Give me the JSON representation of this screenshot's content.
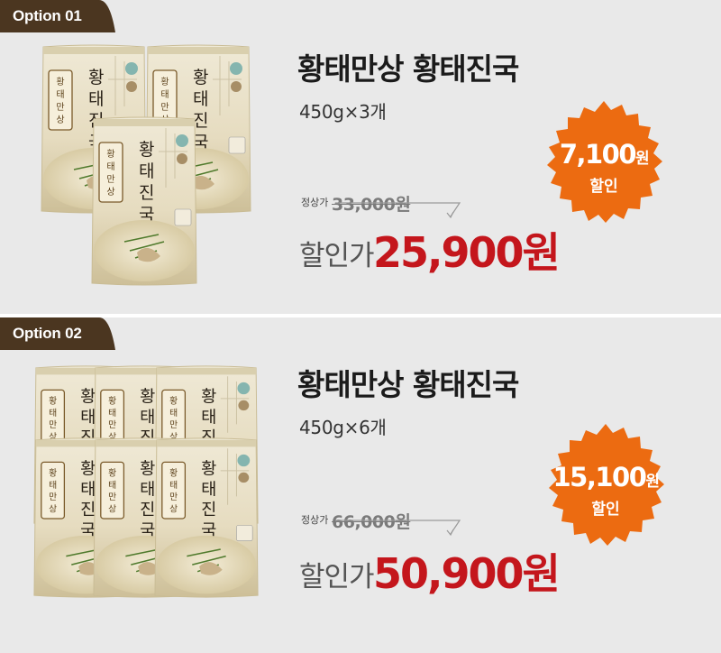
{
  "colors": {
    "tab": "#4b3620",
    "badge": "#ec6b11",
    "sale_price": "#c4161c",
    "panel_bg": "#e9e9e9",
    "pouch": "#e8dfc4"
  },
  "pouch_text": "황태진국",
  "options": [
    {
      "tab_label": "Option 01",
      "title": "황태만상 황태진국",
      "subtitle": "450g×3개",
      "regular_label": "정상가",
      "regular_price": "33,000원",
      "sale_label": "할인가",
      "sale_price": "25,900원",
      "discount_amount": "7,100",
      "discount_unit": "원",
      "discount_label": "할인",
      "pouch_count": 3
    },
    {
      "tab_label": "Option 02",
      "title": "황태만상 황태진국",
      "subtitle": "450g×6개",
      "regular_label": "정상가",
      "regular_price": "66,000원",
      "sale_label": "할인가",
      "sale_price": "50,900원",
      "discount_amount": "15,100",
      "discount_unit": "원",
      "discount_label": "할인",
      "pouch_count": 6
    }
  ]
}
